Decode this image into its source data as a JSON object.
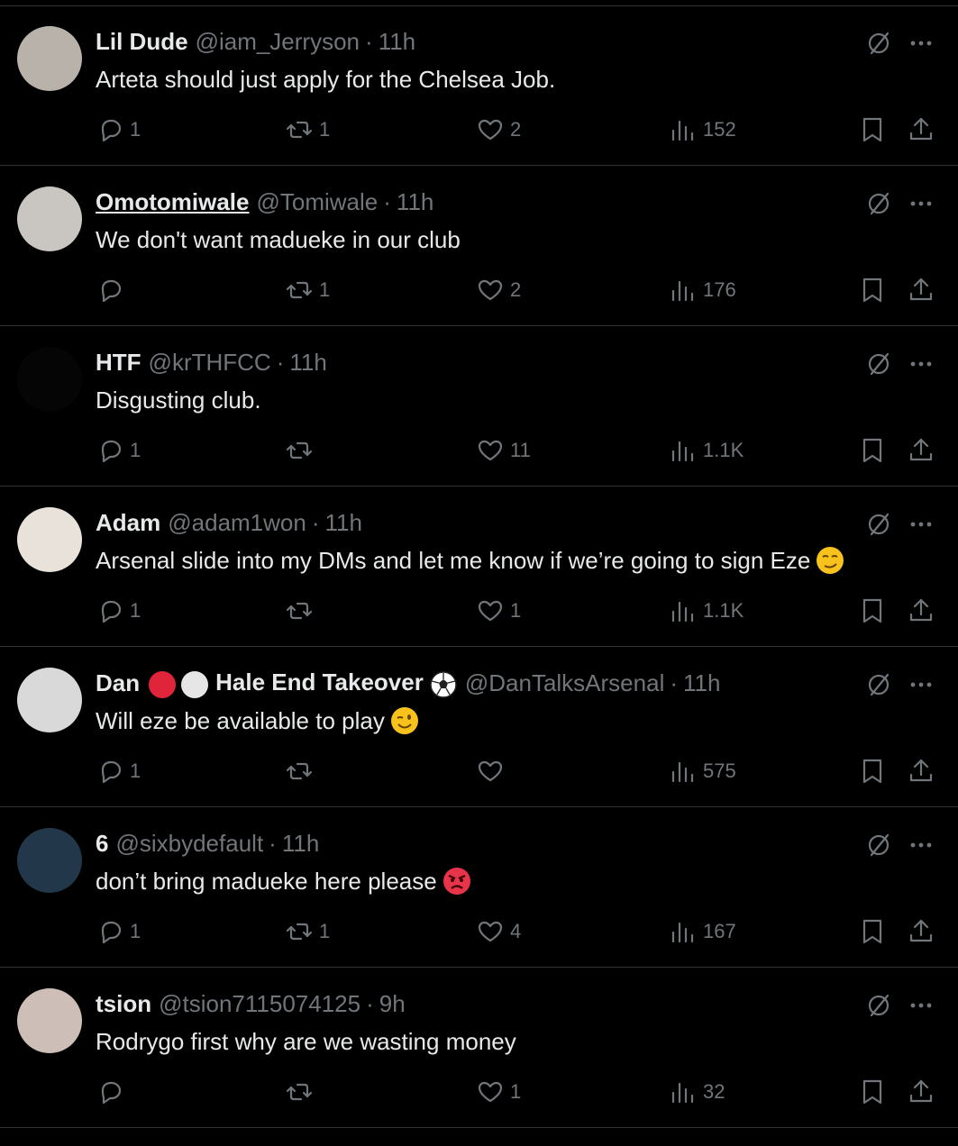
{
  "replies": [
    {
      "name": "Lil Dude",
      "handle": "@iam_Jerryson",
      "time": "11h",
      "text": "Arteta should just apply for the Chelsea Job.",
      "text_emoji": "",
      "name_underline": false,
      "avatar_color": "#b9b2aa",
      "replies": "1",
      "reposts": "1",
      "likes": "2",
      "views": "152"
    },
    {
      "name": "Omotomiwale",
      "handle": "@Tomiwale",
      "time": "11h",
      "text": "We don't want madueke in our club",
      "text_emoji": "",
      "name_underline": true,
      "avatar_color": "#c9c6c2",
      "replies": "",
      "reposts": "1",
      "likes": "2",
      "views": "176"
    },
    {
      "name": "HTF",
      "handle": "@krTHFCC",
      "time": "11h",
      "text": "Disgusting club.",
      "text_emoji": "",
      "name_underline": false,
      "avatar_color": "#050505",
      "replies": "1",
      "reposts": "",
      "likes": "11",
      "views": "1.1K"
    },
    {
      "name": "Adam",
      "handle": "@adam1won",
      "time": "11h",
      "text": "Arsenal slide into my DMs and let me know if we’re going to sign Eze",
      "text_emoji": "smirk-emoji",
      "name_underline": false,
      "avatar_color": "#e8e2da",
      "replies": "1",
      "reposts": "",
      "likes": "1",
      "views": "1.1K"
    },
    {
      "name": "Dan",
      "name_suffix": "Hale End Takeover",
      "handle": "@DanTalksArsenal",
      "time": "11h",
      "text": "Will eze be available to play",
      "text_emoji": "wink-emoji",
      "name_underline": false,
      "avatar_color": "#d9d9d9",
      "replies": "1",
      "reposts": "",
      "likes": "",
      "views": "575"
    },
    {
      "name": "6",
      "handle": "@sixbydefault",
      "time": "11h",
      "text": "don’t bring madueke here please",
      "text_emoji": "angry-emoji",
      "name_underline": false,
      "avatar_color": "#22384a",
      "replies": "1",
      "reposts": "1",
      "likes": "4",
      "views": "167"
    },
    {
      "name": "tsion",
      "handle": "@tsion7115074125",
      "time": "9h",
      "text": "Rodrygo first why are we wasting money",
      "text_emoji": "",
      "name_underline": false,
      "avatar_color": "#cdbfb7",
      "replies": "",
      "reposts": "",
      "likes": "1",
      "views": "32"
    }
  ],
  "colors": {
    "background": "#000000",
    "text_primary": "#e7e9ea",
    "text_secondary": "#71767b",
    "divider": "#2f3336"
  }
}
